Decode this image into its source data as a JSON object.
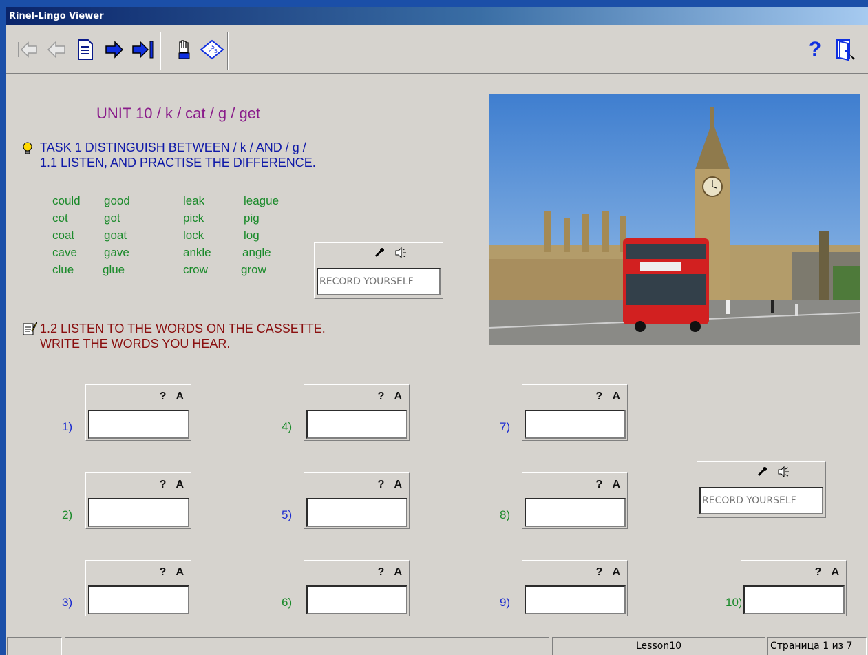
{
  "window": {
    "title": "Rinel-Lingo Viewer"
  },
  "toolbar": {
    "help_label": "?"
  },
  "unit": {
    "title": "UNIT 10  / k / cat   / g / get"
  },
  "task1": {
    "line1": "TASK 1 DISTINGUISH BETWEEN / k / AND / g /",
    "line2": "1.1 LISTEN, AND PRACTISE THE DIFFERENCE.",
    "words": {
      "col1": [
        "could",
        "cot",
        "coat",
        "cave",
        "clue"
      ],
      "col2": [
        "good",
        "got",
        "goat",
        "gave",
        "glue"
      ],
      "col3": [
        "leak",
        "pick",
        "lock",
        "ankle",
        "crow"
      ],
      "col4": [
        "league",
        "pig",
        "log",
        "angle",
        "grow"
      ]
    }
  },
  "recorder": {
    "placeholder": "RECORD YOURSELF"
  },
  "task12": {
    "line1": "1.2 LISTEN TO THE WORDS ON THE CASSETTE.",
    "line2": "WRITE THE WORDS YOU HEAR."
  },
  "answers": {
    "hint_label": "?",
    "answer_label": "A",
    "items": [
      "1)",
      "2)",
      "3)",
      "4)",
      "5)",
      "6)",
      "7)",
      "8)",
      "9)",
      "10)"
    ]
  },
  "status": {
    "lesson": "Lesson10",
    "page": "Страница 1 из 7"
  },
  "colors": {
    "blue_num": "#1a2ad0",
    "green_num": "#1a8a2a"
  }
}
